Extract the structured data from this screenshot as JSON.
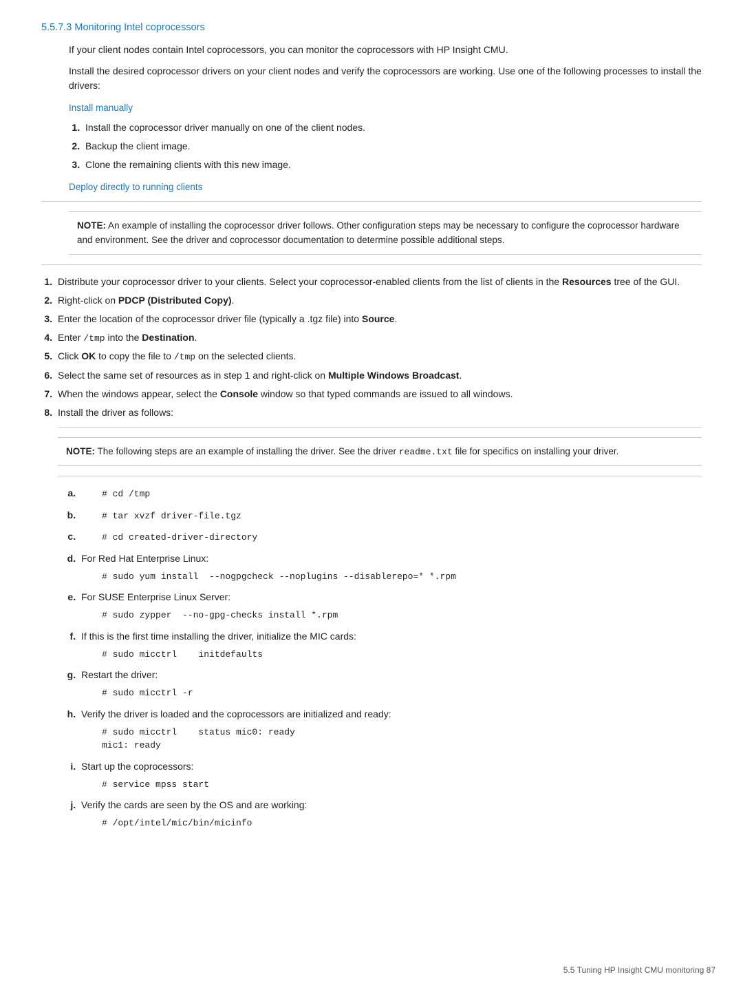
{
  "page": {
    "section_title": "5.5.7.3 Monitoring Intel coprocessors",
    "intro_p1": "If your client nodes contain Intel coprocessors, you can monitor the coprocessors with HP Insight CMU.",
    "intro_p2": "Install the desired coprocessor drivers on your client nodes and verify the coprocessors are working. Use one of the following processes to install the drivers:",
    "install_manually_heading": "Install manually",
    "install_manually_steps": [
      "Install the coprocessor driver manually on one of the client nodes.",
      "Backup the client image.",
      "Clone the remaining clients with this new image."
    ],
    "deploy_directly_heading": "Deploy directly to running clients",
    "note1_label": "NOTE:",
    "note1_text": "   An example of installing the coprocessor driver follows. Other configuration steps may be necessary to configure the coprocessor hardware and environment. See the driver and coprocessor documentation to determine possible additional steps.",
    "deploy_steps": [
      {
        "num": "1.",
        "text_before": "Distribute your coprocessor driver to your clients. Select your coprocessor-enabled clients from the list of clients in the ",
        "bold": "Resources",
        "text_after": " tree of the GUI."
      },
      {
        "num": "2.",
        "text_before": "Right-click on ",
        "bold": "PDCP (Distributed Copy)",
        "text_after": "."
      },
      {
        "num": "3.",
        "text_before": "Enter the location of the coprocessor driver file (typically a .tgz file) into ",
        "bold": "Source",
        "text_after": "."
      },
      {
        "num": "4.",
        "text_before": "Enter ",
        "code": "/tmp",
        "text_mid": " into the ",
        "bold": "Destination",
        "text_after": "."
      },
      {
        "num": "5.",
        "text_before": "Click ",
        "bold": "OK",
        "text_mid": " to copy the file to ",
        "code": "/tmp",
        "text_after": " on the selected clients."
      },
      {
        "num": "6.",
        "text_before": "Select the same set of resources as in step 1 and right-click on ",
        "bold": "Multiple Windows Broadcast",
        "text_after": "."
      },
      {
        "num": "7.",
        "text_before": "When the windows appear, select the ",
        "bold": "Console",
        "text_after": " window so that typed commands are issued to all windows."
      },
      {
        "num": "8.",
        "text_before": "Install the driver as follows:"
      }
    ],
    "note2_label": "NOTE:",
    "note2_text": "   The following steps are an example of installing the driver. See the driver ",
    "note2_code": "readme.txt",
    "note2_text2": " file for specifics on installing your driver.",
    "alpha_steps": [
      {
        "letter": "a.",
        "text": "",
        "code": "# cd /tmp"
      },
      {
        "letter": "b.",
        "text": "",
        "code": "# tar xvzf driver-file.tgz"
      },
      {
        "letter": "c.",
        "text": "",
        "code": "# cd created-driver-directory"
      },
      {
        "letter": "d.",
        "text": "For Red Hat Enterprise Linux:",
        "code": "# sudo yum install  --nogpgcheck --noplugins --disablerepo=* *.rpm"
      },
      {
        "letter": "e.",
        "text": "For SUSE Enterprise Linux Server:",
        "code": "# sudo zypper  --no-gpg-checks install *.rpm"
      },
      {
        "letter": "f.",
        "text": "If this is the first time installing the driver, initialize the MIC cards:",
        "code": "# sudo micctrl    initdefaults"
      },
      {
        "letter": "g.",
        "text": "Restart the driver:",
        "code": "# sudo micctrl -r"
      },
      {
        "letter": "h.",
        "text": "Verify the driver is loaded and the coprocessors are initialized and ready:",
        "code": "# sudo micctrl    status mic0: ready\nmic1: ready"
      },
      {
        "letter": "i.",
        "text": "Start up the coprocessors:",
        "code": "# service mpss start"
      },
      {
        "letter": "j.",
        "text": "Verify the cards are seen by the OS and are working:",
        "code": "# /opt/intel/mic/bin/micinfo"
      }
    ],
    "footer": "5.5 Tuning HP Insight CMU monitoring    87"
  }
}
